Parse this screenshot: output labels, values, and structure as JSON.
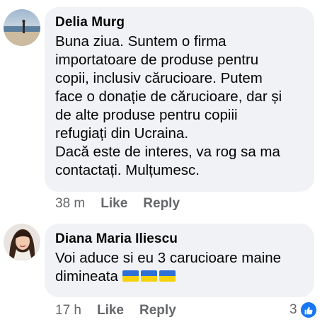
{
  "comments": [
    {
      "author": "Delia Murg",
      "lines": [
        "Buna ziua. Suntem o firma",
        "importatoare de produse pentru",
        "copii, inclusiv cărucioare. Putem",
        "face o donație de cărucioare, dar și",
        "de alte produse pentru copiii",
        "refugiați din Ucraina.",
        "Dacă este de interes, va rog sa ma",
        "contactați. Mulțumesc."
      ],
      "time": "38 m",
      "like_label": "Like",
      "reply_label": "Reply"
    },
    {
      "author": "Diana Maria Iliescu",
      "lines": [
        "Voi aduce si eu 3 carucioare maine",
        "dimineata"
      ],
      "emoji": [
        "ukraine-flag",
        "ukraine-flag",
        "ukraine-flag"
      ],
      "time": "17 h",
      "like_label": "Like",
      "reply_label": "Reply",
      "reaction_count": "3",
      "reaction_icon": "thumbs-up-icon"
    }
  ],
  "colors": {
    "bubble": "#f0f2f5",
    "meta_text": "#65676b",
    "like_blue": "#1877f2",
    "flag_blue": "#2f6fd6",
    "flag_yellow": "#f5d20c"
  }
}
